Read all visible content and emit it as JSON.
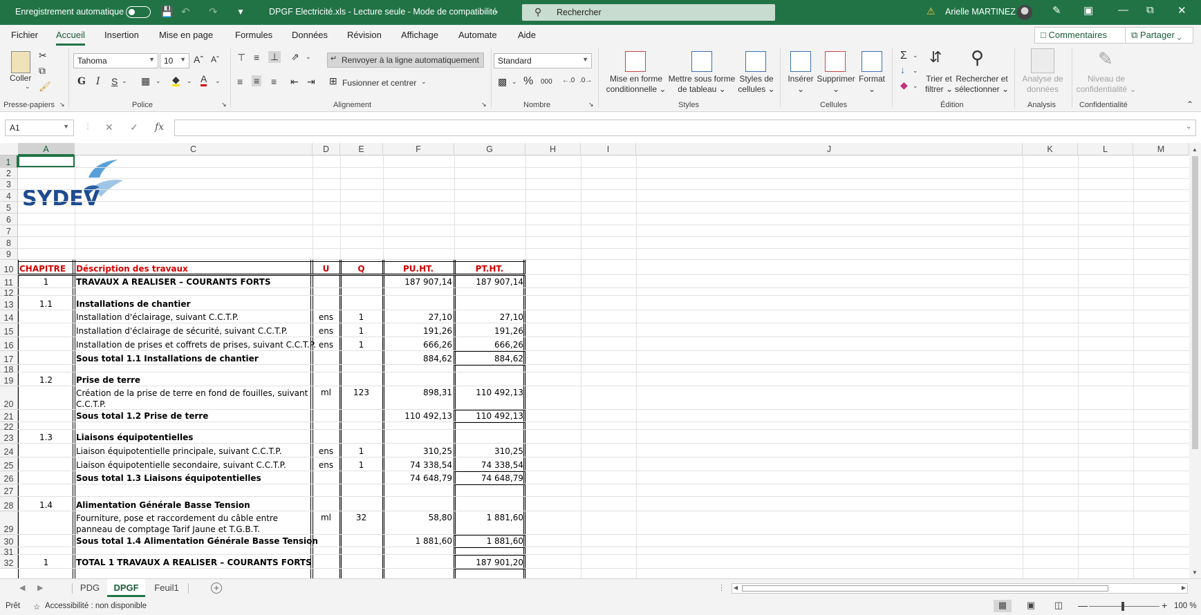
{
  "titlebar": {
    "autosave_label": "Enregistrement automatique",
    "doc_title": "DPGF Electricité.xls  -  Lecture seule  -  Mode de compatibilité",
    "search_placeholder": "Rechercher",
    "user_name": "Arielle MARTINEZ"
  },
  "menu": {
    "tabs": [
      "Fichier",
      "Accueil",
      "Insertion",
      "Mise en page",
      "Formules",
      "Données",
      "Révision",
      "Affichage",
      "Automate",
      "Aide"
    ],
    "active": "Accueil",
    "comments": "Commentaires",
    "share": "Partager"
  },
  "ribbon": {
    "clipboard": {
      "paste": "Coller",
      "label": "Presse-papiers"
    },
    "font": {
      "name": "Tahoma",
      "size": "10",
      "label": "Police",
      "bold": "G",
      "italic": "I",
      "underline": "S"
    },
    "alignment": {
      "wrap": "Renvoyer à la ligne automatiquement",
      "merge": "Fusionner et centrer",
      "label": "Alignement"
    },
    "number": {
      "format": "Standard",
      "percent": "%",
      "thousands": "000",
      "label": "Nombre"
    },
    "styles": {
      "conditional": [
        "Mise en forme",
        "conditionnelle"
      ],
      "table": [
        "Mettre sous forme",
        "de tableau"
      ],
      "cell_styles": [
        "Styles de",
        "cellules"
      ],
      "label": "Styles"
    },
    "cells": {
      "insert": "Insérer",
      "delete": "Supprimer",
      "format": "Format",
      "label": "Cellules"
    },
    "editing": {
      "sort": [
        "Trier et",
        "filtrer"
      ],
      "find": [
        "Rechercher et",
        "sélectionner"
      ],
      "label": "Édition"
    },
    "analysis": {
      "analyze": [
        "Analyse de",
        "données"
      ],
      "label": "Analysis"
    },
    "sensitivity": {
      "level": [
        "Niveau de",
        "confidentialité"
      ],
      "label": "Confidentialité"
    }
  },
  "formula": {
    "namebox": "A1",
    "content": ""
  },
  "columns": [
    "A",
    "C",
    "D",
    "E",
    "F",
    "G",
    "H",
    "I",
    "J",
    "K",
    "L",
    "M"
  ],
  "logo_text": "SYDEV",
  "header": {
    "chapitre": "CHAPITRE",
    "description": "Déscription des travaux",
    "u": "U",
    "q": "Q",
    "pu": "PU.HT.",
    "pt": "PT.HT."
  },
  "rows": [
    {
      "num": "11",
      "chap": "1",
      "desc": "TRAVAUX A REALISER – COURANTS FORTS",
      "u": "",
      "q": "",
      "pu": "187 907,14",
      "pt": "187 907,14",
      "bold": true
    },
    {
      "num": "13",
      "chap": "1.1",
      "desc": "Installations de chantier",
      "u": "",
      "q": "",
      "pu": "",
      "pt": "",
      "bold": true
    },
    {
      "num": "14",
      "chap": "",
      "desc": "Installation d'éclairage, suivant C.C.T.P.",
      "u": "ens",
      "q": "1",
      "pu": "27,10",
      "pt": "27,10"
    },
    {
      "num": "15",
      "chap": "",
      "desc": "Installation d'éclairage de sécurité, suivant C.C.T.P.",
      "u": "ens",
      "q": "1",
      "pu": "191,26",
      "pt": "191,26"
    },
    {
      "num": "16",
      "chap": "",
      "desc": "Installation de prises et coffrets de prises, suivant C.C.T.P.",
      "u": "ens",
      "q": "1",
      "pu": "666,26",
      "pt": "666,26"
    },
    {
      "num": "17",
      "chap": "",
      "desc": "Sous total 1.1 Installations de chantier",
      "u": "",
      "q": "",
      "pu": "884,62",
      "pt": "884,62",
      "bold": true
    },
    {
      "num": "19",
      "chap": "1.2",
      "desc": "Prise de terre",
      "u": "",
      "q": "",
      "pu": "",
      "pt": "",
      "bold": true
    },
    {
      "num": "20",
      "chap": "",
      "desc": "Création de la prise de terre en fond de fouilles, suivant C.C.T.P.",
      "u": "ml",
      "q": "123",
      "pu": "898,31",
      "pt": "110 492,13"
    },
    {
      "num": "21",
      "chap": "",
      "desc": "Sous total 1.2 Prise de terre",
      "u": "",
      "q": "",
      "pu": "110 492,13",
      "pt": "110 492,13",
      "bold": true
    },
    {
      "num": "23",
      "chap": "1.3",
      "desc": "Liaisons équipotentielles",
      "u": "",
      "q": "",
      "pu": "",
      "pt": "",
      "bold": true
    },
    {
      "num": "24",
      "chap": "",
      "desc": "Liaison équipotentielle principale, suivant C.C.T.P.",
      "u": "ens",
      "q": "1",
      "pu": "310,25",
      "pt": "310,25"
    },
    {
      "num": "25",
      "chap": "",
      "desc": "Liaison équipotentielle secondaire, suivant C.C.T.P.",
      "u": "ens",
      "q": "1",
      "pu": "74 338,54",
      "pt": "74 338,54"
    },
    {
      "num": "26",
      "chap": "",
      "desc": "Sous total 1.3 Liaisons équipotentielles",
      "u": "",
      "q": "",
      "pu": "74 648,79",
      "pt": "74 648,79",
      "bold": true
    },
    {
      "num": "28",
      "chap": "1.4",
      "desc": "Alimentation Générale Basse Tension",
      "u": "",
      "q": "",
      "pu": "",
      "pt": "",
      "bold": true
    },
    {
      "num": "29",
      "chap": "",
      "desc": "Fourniture, pose et raccordement du câble entre panneau de comptage Tarif Jaune et T.G.B.T.",
      "u": "ml",
      "q": "32",
      "pu": "58,80",
      "pt": "1 881,60"
    },
    {
      "num": "30",
      "chap": "",
      "desc": "Sous total 1.4 Alimentation Générale Basse Tension",
      "u": "",
      "q": "",
      "pu": "1 881,60",
      "pt": "1 881,60",
      "bold": true
    },
    {
      "num": "32",
      "chap": "1",
      "desc": "TOTAL 1 TRAVAUX A REALISER – COURANTS FORTS",
      "u": "",
      "q": "",
      "pu": "",
      "pt": "187 901,20",
      "bold": true
    }
  ],
  "row_numbers": [
    "1",
    "2",
    "3",
    "4",
    "5",
    "6",
    "7",
    "8",
    "9",
    "10",
    "11",
    "12",
    "13",
    "14",
    "15",
    "16",
    "17",
    "18",
    "19",
    "20",
    "21",
    "22",
    "23",
    "24",
    "25",
    "26",
    "27",
    "28",
    "29",
    "30",
    "31",
    "32"
  ],
  "sheets": [
    "PDG",
    "DPGF",
    "Feuil1"
  ],
  "active_sheet": "DPGF",
  "status": {
    "ready": "Prêt",
    "accessibility": "Accessibilité : non disponible",
    "zoom": "100 %"
  }
}
